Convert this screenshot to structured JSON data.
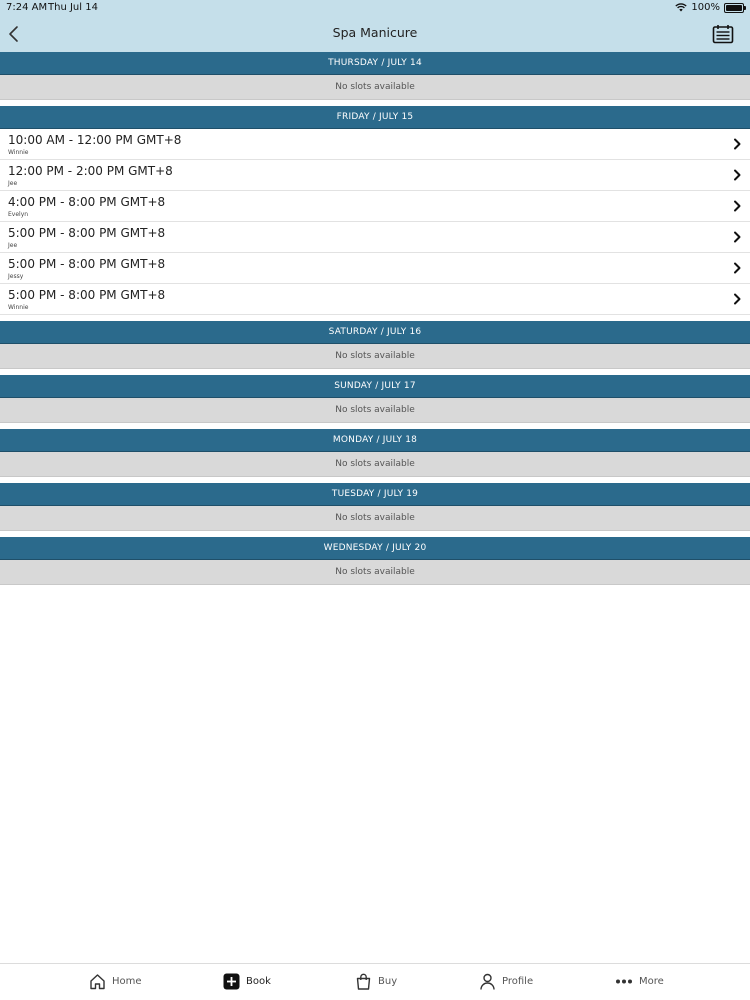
{
  "status": {
    "time": "7:24 AM",
    "date": "Thu Jul 14",
    "battery": "100%"
  },
  "nav": {
    "title": "Spa Manicure"
  },
  "days": [
    {
      "header": "THURSDAY / JULY 14",
      "slots": [],
      "empty": "No slots available"
    },
    {
      "header": "FRIDAY / JULY 15",
      "empty": "",
      "slots": [
        {
          "time": "10:00 AM - 12:00 PM GMT+8",
          "staff": "Winnie"
        },
        {
          "time": "12:00 PM - 2:00 PM GMT+8",
          "staff": "Jee"
        },
        {
          "time": "4:00 PM - 8:00 PM GMT+8",
          "staff": "Evelyn"
        },
        {
          "time": "5:00 PM - 8:00 PM GMT+8",
          "staff": "Jee"
        },
        {
          "time": "5:00 PM - 8:00 PM GMT+8",
          "staff": "Jessy"
        },
        {
          "time": "5:00 PM - 8:00 PM GMT+8",
          "staff": "Winnie"
        }
      ]
    },
    {
      "header": "SATURDAY / JULY 16",
      "slots": [],
      "empty": "No slots available"
    },
    {
      "header": "SUNDAY / JULY 17",
      "slots": [],
      "empty": "No slots available"
    },
    {
      "header": "MONDAY / JULY 18",
      "slots": [],
      "empty": "No slots available"
    },
    {
      "header": "TUESDAY / JULY 19",
      "slots": [],
      "empty": "No slots available"
    },
    {
      "header": "WEDNESDAY / JULY 20",
      "slots": [],
      "empty": "No slots available"
    }
  ],
  "tabs": [
    {
      "label": "Home",
      "icon": "home-icon"
    },
    {
      "label": "Book",
      "icon": "plus-square-icon"
    },
    {
      "label": "Buy",
      "icon": "shopping-bag-icon"
    },
    {
      "label": "Profile",
      "icon": "person-icon"
    },
    {
      "label": "More",
      "icon": "ellipsis-icon"
    }
  ],
  "colors": {
    "header_bar": "#c5dfea",
    "day_header": "#2b6a8c",
    "empty_row": "#d9d9d9"
  }
}
